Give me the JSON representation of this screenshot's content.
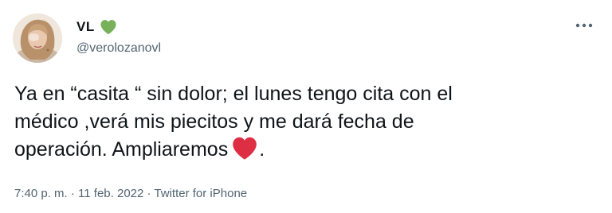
{
  "author": {
    "display_name": "VL",
    "handle": "@verolozanovl",
    "badge_icon": "green-heart-icon",
    "badge_color": "#78b159"
  },
  "more_icon": "more-horizontal-icon",
  "tweet": {
    "lines": [
      "Ya en “casita “ sin dolor; el lunes tengo cita con el",
      "médico ,verá mis piecitos y me dará fecha de",
      "operación. Ampliaremos"
    ],
    "trailing_text": ".",
    "emoji_icon": "red-heart-icon",
    "emoji_color": "#dd2e44"
  },
  "meta": {
    "time": "7:40 p. m.",
    "separator": " · ",
    "date": "11 feb. 2022",
    "source": "Twitter for iPhone"
  }
}
